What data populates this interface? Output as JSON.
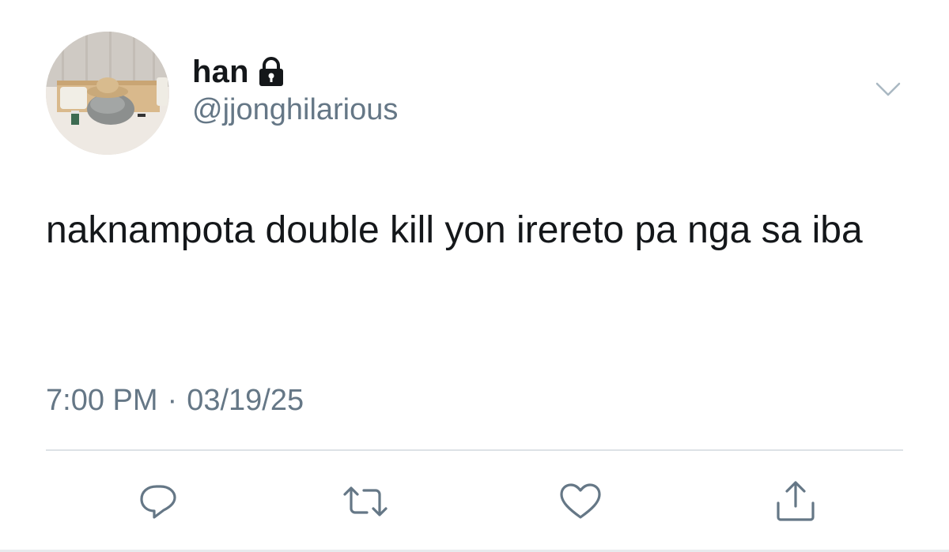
{
  "user": {
    "display_name": "han",
    "handle": "@jjonghilarious",
    "avatar_icon": "avatar-photo",
    "protected_icon": "lock-icon"
  },
  "tweet": {
    "text": "naknampota double kill yon irereto pa nga sa iba",
    "time": "7:00 PM",
    "separator": "·",
    "date": "03/19/25"
  },
  "actions": [
    {
      "name": "reply",
      "icon": "reply-icon"
    },
    {
      "name": "retweet",
      "icon": "retweet-icon"
    },
    {
      "name": "like",
      "icon": "heart-icon"
    },
    {
      "name": "share",
      "icon": "share-icon"
    }
  ],
  "colors": {
    "text": "#14171a",
    "secondary": "#657786",
    "divider": "#dde2e6",
    "icon": "#657786"
  }
}
